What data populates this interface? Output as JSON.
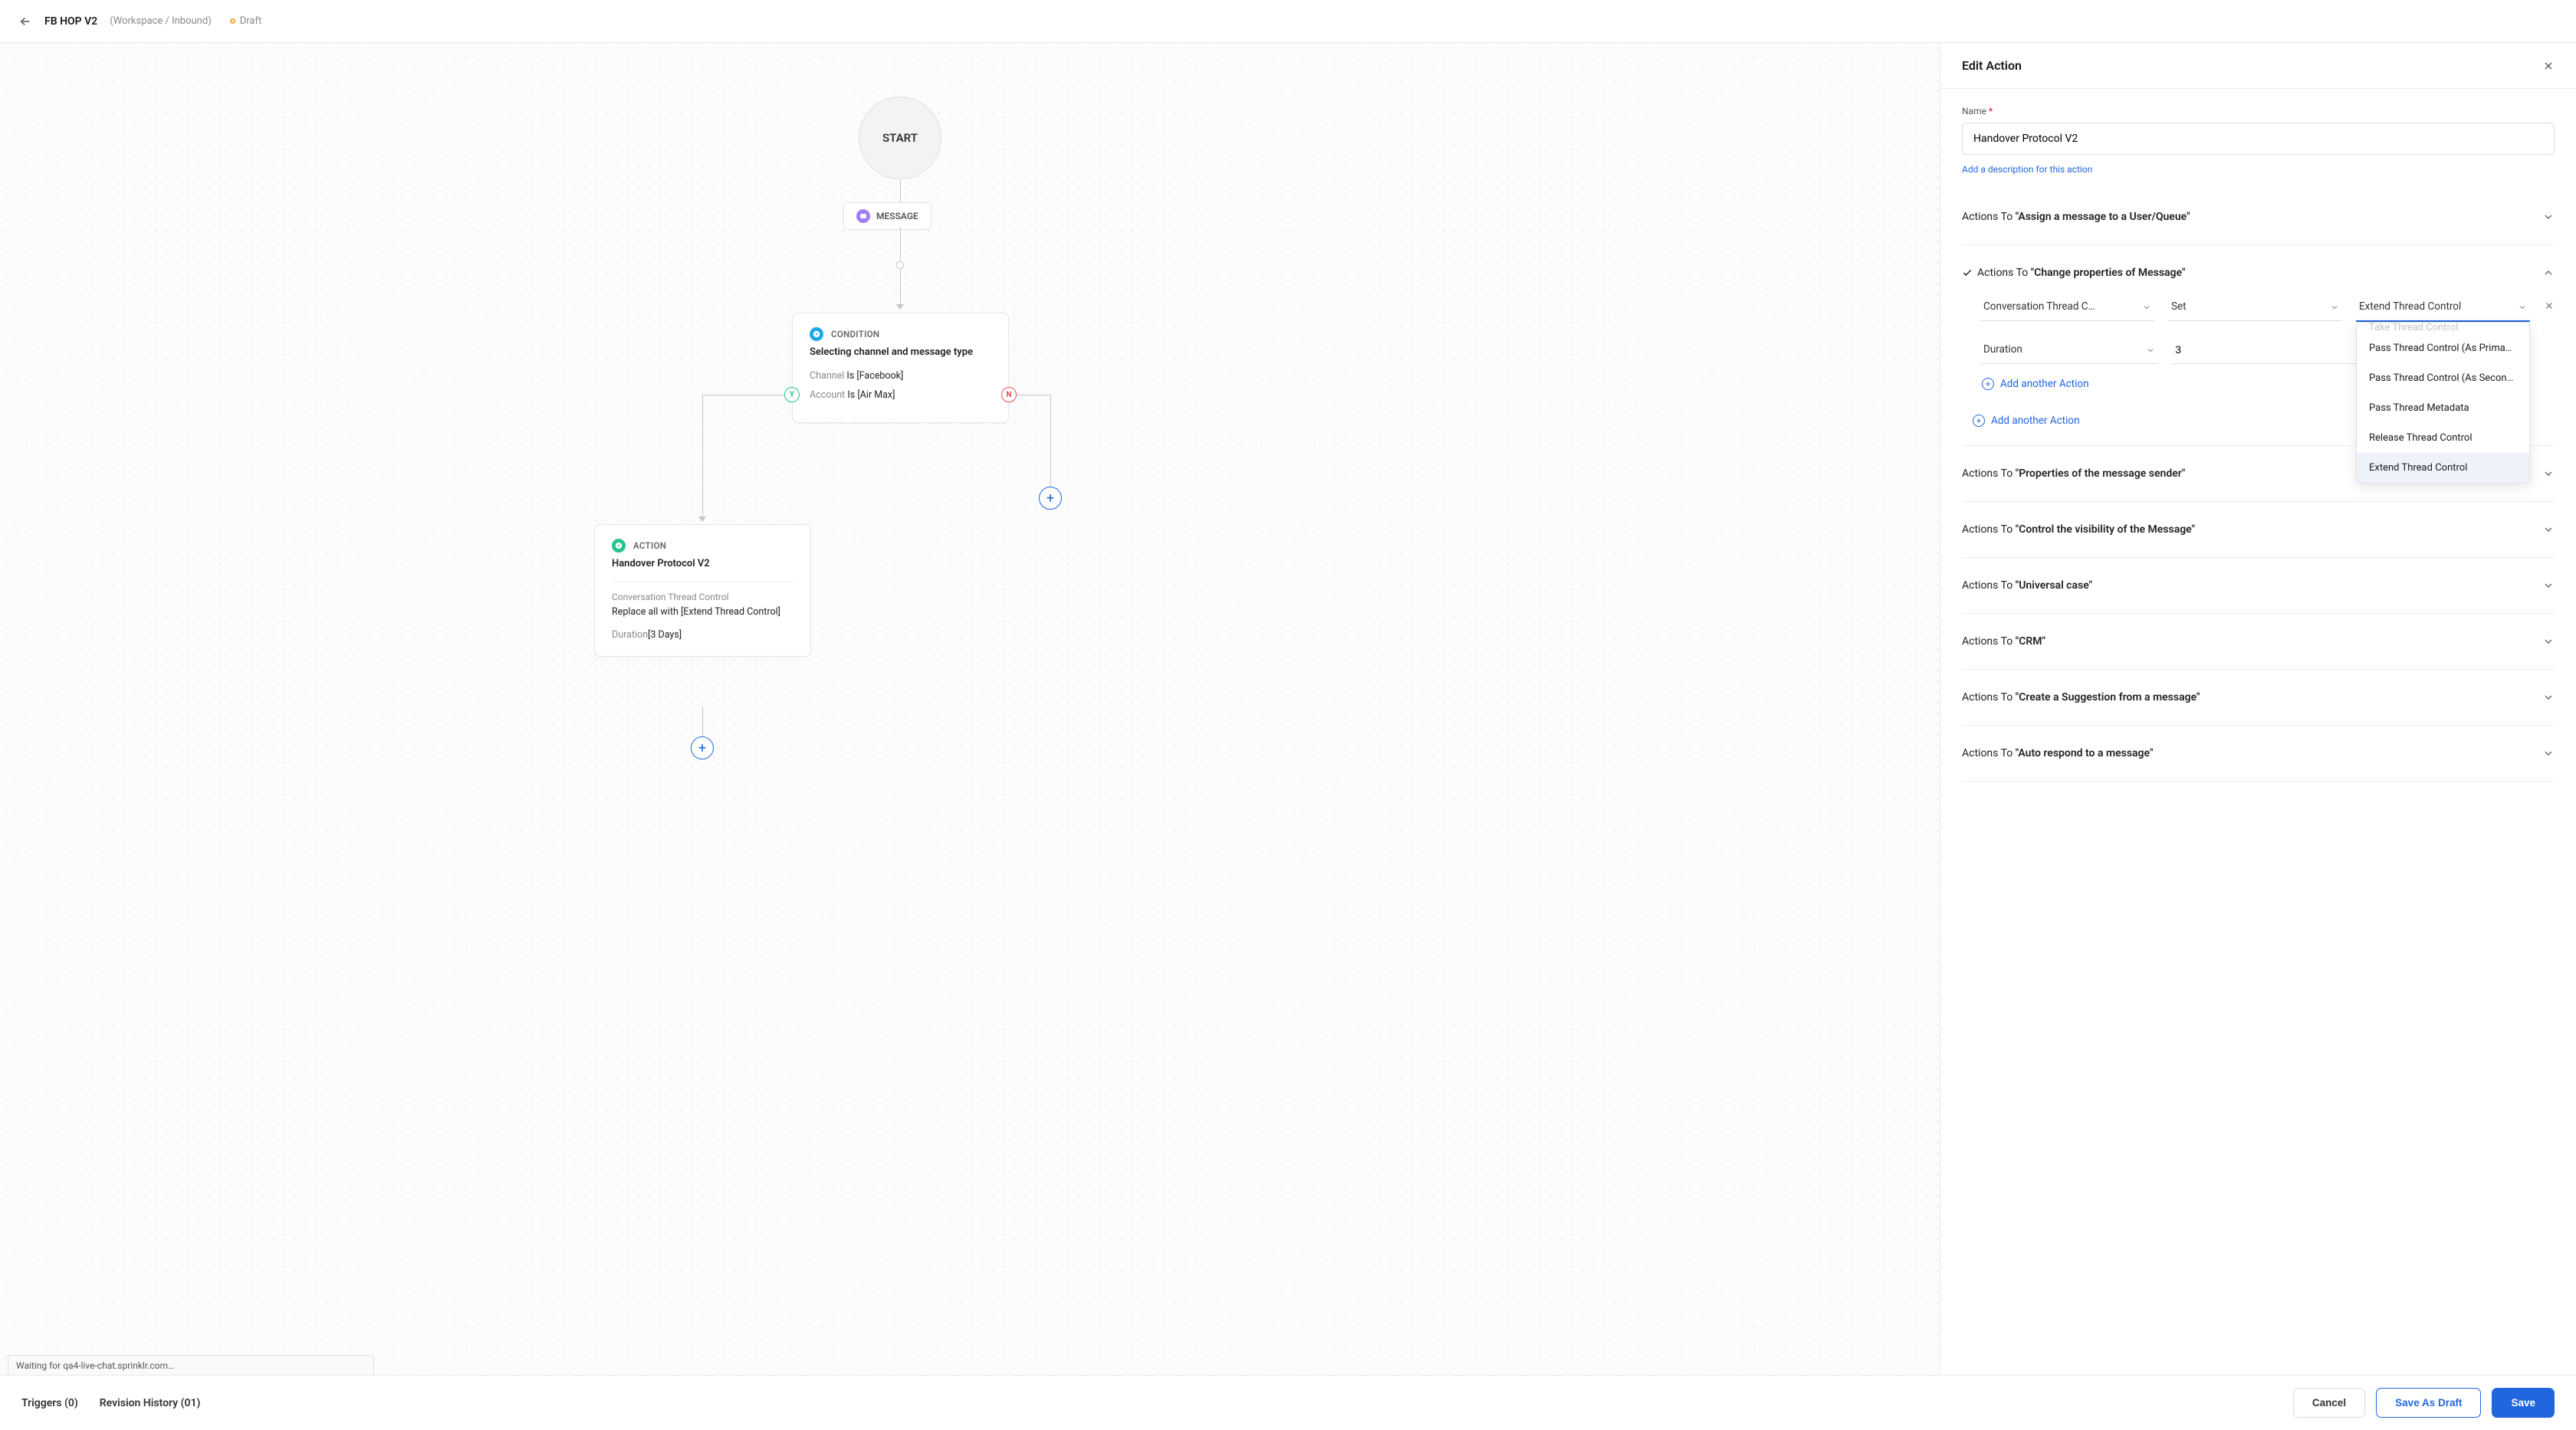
{
  "header": {
    "title": "FB HOP V2",
    "breadcrumb": "(Workspace / Inbound)",
    "status": "Draft"
  },
  "canvas": {
    "start": "START",
    "message": "MESSAGE",
    "condition": {
      "type": "CONDITION",
      "title": "Selecting channel and message type",
      "rows": [
        {
          "field": "Channel",
          "op": "Is",
          "value": "[Facebook]"
        },
        {
          "field": "Account",
          "op": "Is",
          "value": "[Air Max]"
        }
      ],
      "y": "Y",
      "n": "N"
    },
    "action": {
      "type": "ACTION",
      "title": "Handover Protocol V2",
      "prop": "Conversation Thread Control",
      "replace": "Replace all with [Extend Thread Control]",
      "duration_label": "Duration",
      "duration_value": "[3 Days]"
    }
  },
  "panel": {
    "title": "Edit Action",
    "name_label": "Name",
    "name_value": "Handover Protocol V2",
    "desc_link": "Add a description for this action",
    "sections": [
      {
        "prefix": "Actions To",
        "quoted": "\"Assign a message to a User/Queue\""
      },
      {
        "prefix": "Actions To",
        "quoted": "\"Change properties of Message\"",
        "open": true,
        "checked": true
      },
      {
        "prefix": "Actions To",
        "quoted": "\"Properties of the message sender\""
      },
      {
        "prefix": "Actions To",
        "quoted": "\"Control the visibility of the Message\""
      },
      {
        "prefix": "Actions To",
        "quoted": "\"Universal case\""
      },
      {
        "prefix": "Actions To",
        "quoted": "\"CRM\""
      },
      {
        "prefix": "Actions To",
        "quoted": "\"Create a Suggestion from a message\""
      },
      {
        "prefix": "Actions To",
        "quoted": "\"Auto respond to a message\""
      }
    ],
    "open_section": {
      "field1": "Conversation Thread C…",
      "field2": "Set",
      "field3": "Extend Thread Control",
      "duration_label": "Duration",
      "duration_value": "3",
      "add_inner": "Add another Action",
      "add_outer": "Add another Action"
    },
    "dropdown": {
      "options": [
        "Take Thread Control",
        "Pass Thread Control (As Prima…",
        "Pass Thread Control (As Secon…",
        "Pass Thread Metadata",
        "Release Thread Control",
        "Extend Thread Control"
      ],
      "selected": "Extend Thread Control"
    }
  },
  "footer": {
    "triggers": "Triggers (0)",
    "revision": "Revision History (01)",
    "cancel": "Cancel",
    "draft": "Save As Draft",
    "save": "Save"
  },
  "status": "Waiting for qa4-live-chat.sprinklr.com…"
}
